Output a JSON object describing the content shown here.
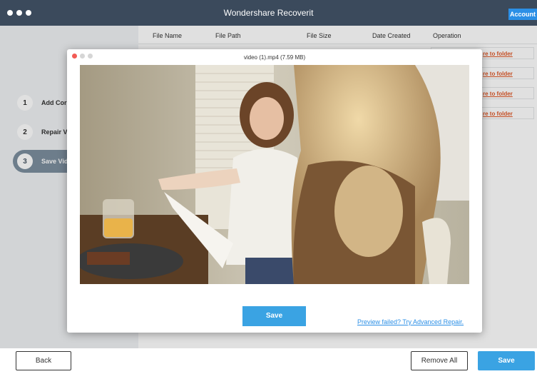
{
  "app": {
    "title": "Wondershare Recoverit",
    "account_label": "Account"
  },
  "sidebar": {
    "steps": [
      {
        "number": "1",
        "label": "Add Corru"
      },
      {
        "number": "2",
        "label": "Repair Vid"
      },
      {
        "number": "3",
        "label": "Save Vide"
      }
    ],
    "active_step": 3
  },
  "table": {
    "columns": [
      "File Name",
      "File Path",
      "File Size",
      "Date Created",
      "Operation"
    ],
    "row_actions": [
      "re to folder",
      "re to folder",
      "re to folder",
      "re to folder"
    ]
  },
  "preview": {
    "title": "video (1).mp4 (7.59 MB)",
    "save_label": "Save",
    "advanced_link": "Preview failed? Try Advanced Repair."
  },
  "footer": {
    "back_label": "Back",
    "remove_all_label": "Remove All",
    "save_label": "Save"
  },
  "colors": {
    "titlebar": "#3b4a5c",
    "accent": "#3aa3e3",
    "link_orange": "#e05a2a",
    "link_blue": "#2b8fe6",
    "sidebar_active": "#7d8f9f"
  },
  "icons": [
    "window-control-icon",
    "close-dot-icon",
    "minimize-dot-icon",
    "zoom-dot-icon"
  ]
}
